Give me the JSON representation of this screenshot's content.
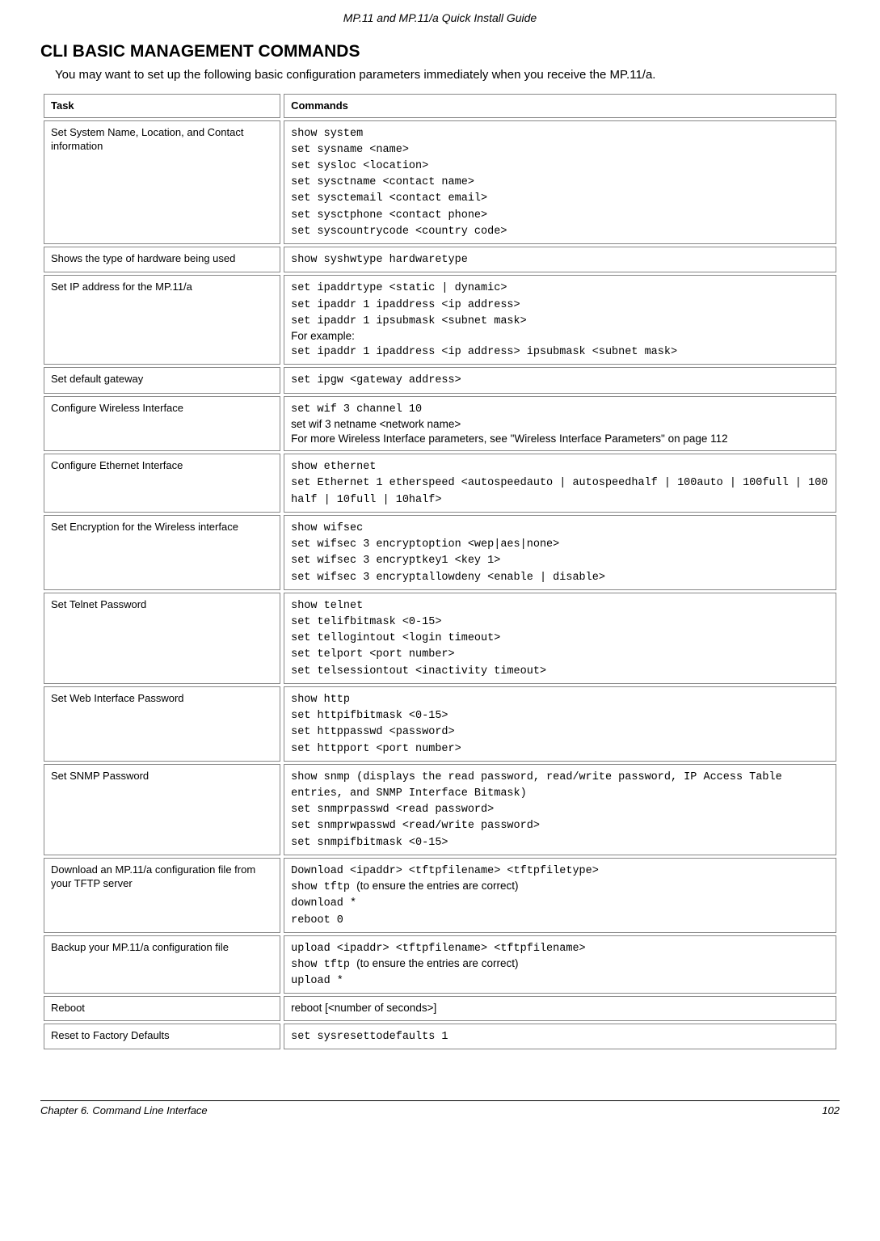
{
  "header": {
    "title": "MP.11 and MP.11/a Quick Install Guide"
  },
  "section": {
    "heading": "CLI BASIC MANAGEMENT COMMANDS",
    "intro": "You may want to set up the following basic configuration parameters immediately when you receive the MP.11/a."
  },
  "table": {
    "header_task": "Task",
    "header_commands": "Commands",
    "rows": [
      {
        "task": "Set System Name, Location, and Contact information",
        "segments": [
          {
            "text": "show system\nset sysname <name>\nset sysloc <location>\nset sysctname <contact name>\nset sysctemail <contact email>\nset sysctphone <contact phone>\nset syscountrycode <country code>",
            "mono": true
          }
        ]
      },
      {
        "task": "Shows the type of hardware being used",
        "segments": [
          {
            "text": "show syshwtype hardwaretype",
            "mono": true
          }
        ]
      },
      {
        "task": "Set IP address for the MP.11/a",
        "segments": [
          {
            "text": "set ipaddrtype <static | dynamic>\nset ipaddr 1 ipaddress <ip address>\nset ipaddr 1 ipsubmask <subnet mask>",
            "mono": true
          },
          {
            "text": "For example:",
            "mono": false
          },
          {
            "text": "set ipaddr 1 ipaddress <ip address> ipsubmask <subnet mask>",
            "mono": true
          }
        ]
      },
      {
        "task": "Set default gateway",
        "segments": [
          {
            "text": "set ipgw <gateway address>",
            "mono": true
          }
        ]
      },
      {
        "task": "Configure Wireless Interface",
        "segments": [
          {
            "text": "set wif 3 channel 10",
            "mono": true
          },
          {
            "text": "set wif 3 netname <network name>",
            "mono": false
          },
          {
            "text": "For more Wireless Interface parameters, see \"Wireless Interface Parameters\" on page 112",
            "mono": false
          }
        ]
      },
      {
        "task": "Configure Ethernet Interface",
        "segments": [
          {
            "text": "show ethernet\nset Ethernet 1 etherspeed <autospeedauto | autospeedhalf | 100auto | 100full | 100 half | 10full | 10half>",
            "mono": true
          }
        ]
      },
      {
        "task": "Set Encryption for the Wireless interface",
        "segments": [
          {
            "text": "show wifsec\nset wifsec 3 encryptoption <wep|aes|none>\nset wifsec 3 encryptkey1 <key 1>\nset wifsec 3 encryptallowdeny <enable | disable>",
            "mono": true
          }
        ]
      },
      {
        "task": "Set Telnet Password",
        "segments": [
          {
            "text": "show telnet\nset telifbitmask <0-15>\nset tellogintout <login timeout>\nset telport <port number>\nset telsessiontout <inactivity timeout>",
            "mono": true
          }
        ]
      },
      {
        "task": "Set Web Interface Password",
        "segments": [
          {
            "text": "show http\nset httpifbitmask <0-15>\nset httppasswd <password>\nset httpport <port number>",
            "mono": true
          }
        ]
      },
      {
        "task": "Set SNMP Password",
        "segments": [
          {
            "text": "show snmp (displays the read password, read/write password, IP Access Table entries, and SNMP Interface Bitmask)\nset snmprpasswd <read password>\nset snmprwpasswd <read/write password>\nset snmpifbitmask <0-15>",
            "mono": true
          }
        ]
      },
      {
        "task": "Download an MP.11/a configuration file from your TFTP server",
        "segments": [
          {
            "text": "Download <ipaddr> <tftpfilename> <tftpfiletype>",
            "mono": true
          },
          {
            "text": "show tftp ",
            "mono": true,
            "inline": true
          },
          {
            "text": "(to ensure the entries are correct)",
            "mono": false,
            "inline": true
          },
          {
            "text": "download *\nreboot 0",
            "mono": true
          }
        ]
      },
      {
        "task": "Backup your MP.11/a configuration file",
        "segments": [
          {
            "text": "upload <ipaddr> <tftpfilename> <tftpfilename>",
            "mono": true
          },
          {
            "text": "show tftp ",
            "mono": true,
            "inline": true
          },
          {
            "text": "(to ensure the entries are correct)",
            "mono": false,
            "inline": true
          },
          {
            "text": "upload *",
            "mono": true
          }
        ]
      },
      {
        "task": "Reboot",
        "segments": [
          {
            "text": "reboot [<number of seconds>]",
            "mono": false
          }
        ]
      },
      {
        "task": "Reset to Factory Defaults",
        "segments": [
          {
            "text": "set sysresettodefaults 1",
            "mono": true
          }
        ]
      }
    ]
  },
  "footer": {
    "chapter": "Chapter 6.  Command Line Interface",
    "page": "102"
  }
}
